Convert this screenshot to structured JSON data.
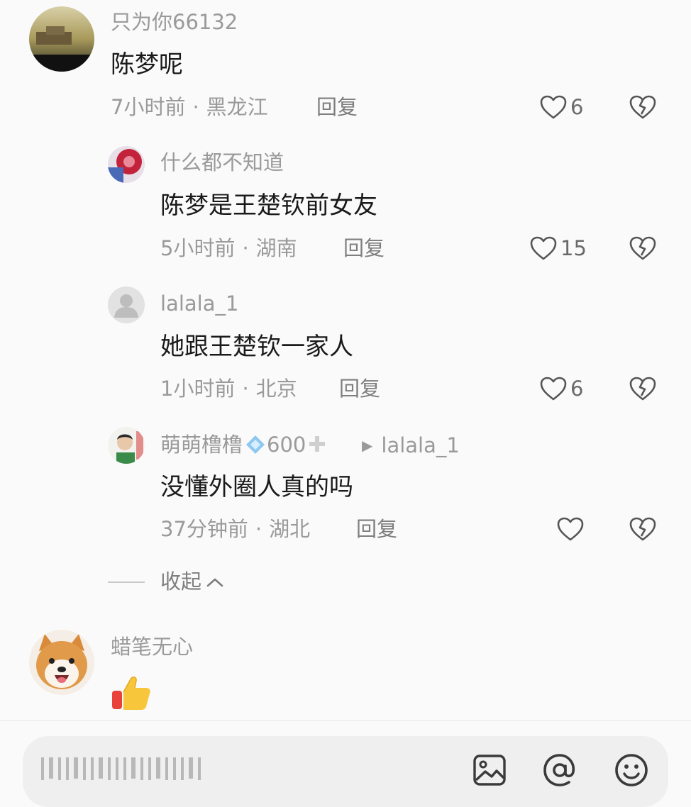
{
  "comments": [
    {
      "username": "只为你66132",
      "text": "陈梦呢",
      "time": "7小时前",
      "location": "黑龙江",
      "reply_label": "回复",
      "likes": "6"
    },
    {
      "username": "什么都不知道",
      "text": "陈梦是王楚钦前女友",
      "time": "5小时前",
      "location": "湖南",
      "reply_label": "回复",
      "likes": "15"
    },
    {
      "username": "lalala_1",
      "text": "她跟王楚钦一家人",
      "time": "1小时前",
      "location": "北京",
      "reply_label": "回复",
      "likes": "6"
    },
    {
      "username": "萌萌橹橹",
      "badge_count": "600",
      "reply_to": "lalala_1",
      "text": "没懂外圈人真的吗",
      "time": "37分钟前",
      "location": "湖北",
      "reply_label": "回复",
      "likes": ""
    },
    {
      "username": "蜡笔无心",
      "text_emoji": "thumbs-up"
    }
  ],
  "meta_separator": "·",
  "collapse_label": "收起",
  "input_bar": {
    "icons": [
      "image-icon",
      "at-icon",
      "emoji-icon"
    ]
  },
  "colors": {
    "background": "#fafafa",
    "muted_text": "#9a9a9a",
    "main_text": "#1a1a1a",
    "input_bg": "#efefef"
  }
}
